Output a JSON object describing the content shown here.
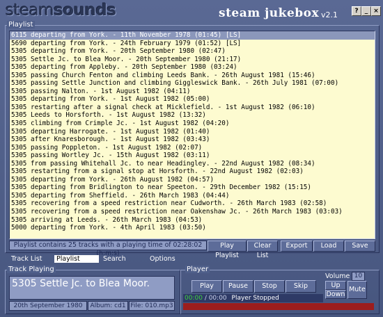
{
  "app": {
    "logo_a": "steam",
    "logo_b": "sounds",
    "title": "steam jukebox",
    "version": "v2.1",
    "window_buttons": [
      "?",
      "_",
      "□",
      "×"
    ]
  },
  "playlist": {
    "label": "Playlist",
    "items": [
      "6115 departing from York. - 11th November 1978 (01:45) [LS]",
      "5690 departing from York. - 24th February 1979 (01:52) [LS]",
      "5305 departing from York. - 20th September 1980 (02:47)",
      "5305 Settle Jc. to Blea Moor. - 20th September 1980 (21:17)",
      "5305 departing from Appleby. - 20th September 1980 (03:24)",
      "5305 passing Church Fenton and climbing Leeds Bank. - 26th August 1981 (15:46)",
      "5305 passing Settle Junction and climbing Giggleswick Bank. - 26th July 1981 (07:00)",
      "5305 passing Nalton. - 1st August 1982 (04:11)",
      "5305 departing from York. - 1st August 1982 (05:00)",
      "5305 restarting after a signal check at Micklefield. - 1st August 1982 (06:10)",
      "5305 Leeds to Horsforth. - 1st August 1982 (13:32)",
      "5305 climbing from Crimple Jc. - 1st August 1982 (04:20)",
      "5305 departing Harrogate. - 1st August 1982 (01:40)",
      "5305 after Knaresborough. - 1st August 1982 (03:43)",
      "5305 passing Poppleton. - 1st August 1982 (02:07)",
      "5305 passing Wortley Jc. - 15th August 1982 (03:11)",
      "5305 from passing Whitehall Jc. to near Headingley. - 22nd August 1982 (08:34)",
      "5305 restarting from a signal stop at Horsforth. - 22nd August 1982 (02:03)",
      "5305 departing from York. - 26th August 1982 (04:57)",
      "5305 departing from Bridlington to near Speeton. - 29th December 1982 (15:15)",
      "5305 departing from Sheffield. - 26th March 1983 (04:44)",
      "5305 recovering from a speed restriction near Cudworth. - 26th March 1983 (02:58)",
      "5305 recovering from a speed restriction near Oakenshaw Jc. - 26th March 1983 (03:03)",
      "5305 arriving at Leeds. - 26th March 1983 (04:53)",
      "5000 departing from York. - 4th April 1983 (03:50)"
    ],
    "selected_index": 0,
    "status": "Playlist contains 25 tracks with a playing time of 02:28:02 (h:m:s)",
    "buttons": [
      "Play Playlist",
      "Clear List",
      "Export",
      "Load",
      "Save"
    ]
  },
  "tabs": [
    "Track List",
    "Playlist",
    "Search",
    "Options"
  ],
  "active_tab": "Playlist",
  "track_playing": {
    "label": "Track Playing",
    "title": "5305 Settle Jc. to Blea Moor.",
    "date": "20th September 1980",
    "album": "Album: cd1",
    "file": "File: 010.mp3"
  },
  "player": {
    "label": "Player",
    "buttons": [
      "Play",
      "Pause",
      "Stop",
      "Skip"
    ],
    "volume_label": "Volume",
    "volume_value": "10",
    "volume_up": "Up",
    "volume_down": "Down",
    "mute": "Mute",
    "time_elapsed": "00:00",
    "time_total": "/ 00:00",
    "status": "Player Stopped"
  },
  "colors": {
    "list_bg": "#fdfbd0",
    "selected_row": "#8b97bb",
    "progress": "#9c1d1d",
    "time_green": "#3fd13f"
  }
}
